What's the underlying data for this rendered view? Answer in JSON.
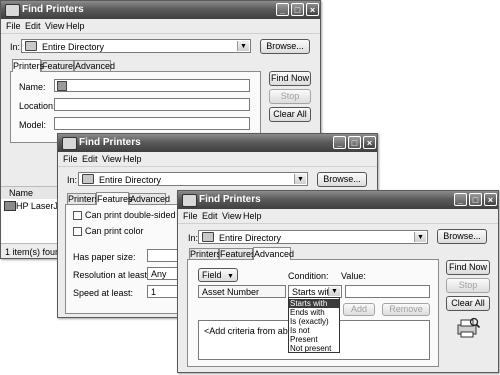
{
  "window_title": "Find Printers",
  "menu": [
    "File",
    "Edit",
    "View",
    "Help"
  ],
  "in_label": "In:",
  "in_value": "Entire Directory",
  "browse_label": "Browse...",
  "tabs": [
    "Printers",
    "Features",
    "Advanced"
  ],
  "buttons": {
    "find_now": "Find Now",
    "stop": "Stop",
    "clear_all": "Clear All"
  },
  "printers_tab": {
    "name_label": "Name:",
    "location_label": "Location:",
    "model_label": "Model:"
  },
  "results": {
    "column_name": "Name",
    "row_name": "HP LaserJet 1",
    "status": "1 item(s) found"
  },
  "features_tab": {
    "can_print_double_sided": "Can print double-sided",
    "can_print_color": "Can print color",
    "has_paper_size_label": "Has paper size:",
    "resolution_label": "Resolution at least:",
    "resolution_value": "Any",
    "speed_label": "Speed at least:",
    "speed_value": "1"
  },
  "advanced_tab": {
    "field_button": "Field",
    "condition_label": "Condition:",
    "value_label": "Value:",
    "field_value": "Asset Number",
    "condition_value": "Starts with",
    "condition_options": [
      "Starts with",
      "Ends with",
      "Is (exactly)",
      "Is not",
      "Present",
      "Not present"
    ],
    "add_button": "Add",
    "remove_button": "Remove",
    "criteria_placeholder": "<Add criteria from above to"
  }
}
